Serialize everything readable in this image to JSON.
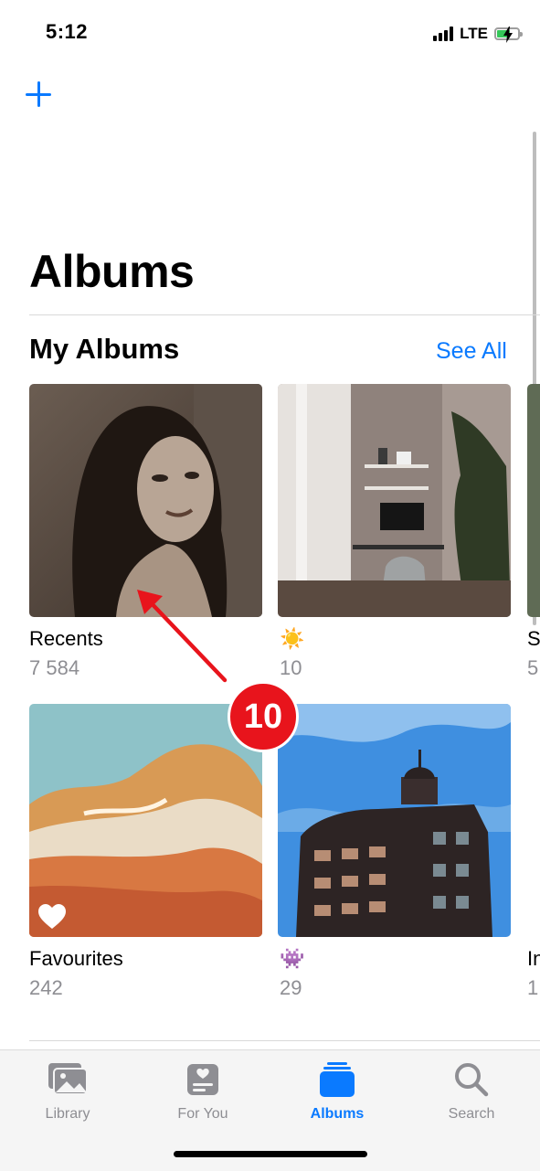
{
  "status_bar": {
    "time": "5:12",
    "network": "LTE",
    "colors": {
      "battery": "#34c759"
    }
  },
  "header": {
    "add_icon": "plus-icon",
    "title": "Albums"
  },
  "my_albums": {
    "section_title": "My Albums",
    "see_all_label": "See All",
    "albums": [
      {
        "name": "Recents",
        "count": "7 584"
      },
      {
        "name": "☀️",
        "count": "10"
      },
      {
        "name": "S",
        "count": "5"
      },
      {
        "name": "Favourites",
        "count": "242"
      },
      {
        "name": "👾",
        "count": "29"
      },
      {
        "name": "In",
        "count": "1"
      }
    ]
  },
  "annotation": {
    "badge_text": "10"
  },
  "tab_bar": {
    "tabs": [
      {
        "label": "Library",
        "icon": "photos-icon",
        "active": false
      },
      {
        "label": "For You",
        "icon": "for-you-icon",
        "active": false
      },
      {
        "label": "Albums",
        "icon": "albums-icon",
        "active": true
      },
      {
        "label": "Search",
        "icon": "search-icon",
        "active": false
      }
    ]
  },
  "colors": {
    "accent": "#0a7aff",
    "badge": "#e8141c"
  }
}
